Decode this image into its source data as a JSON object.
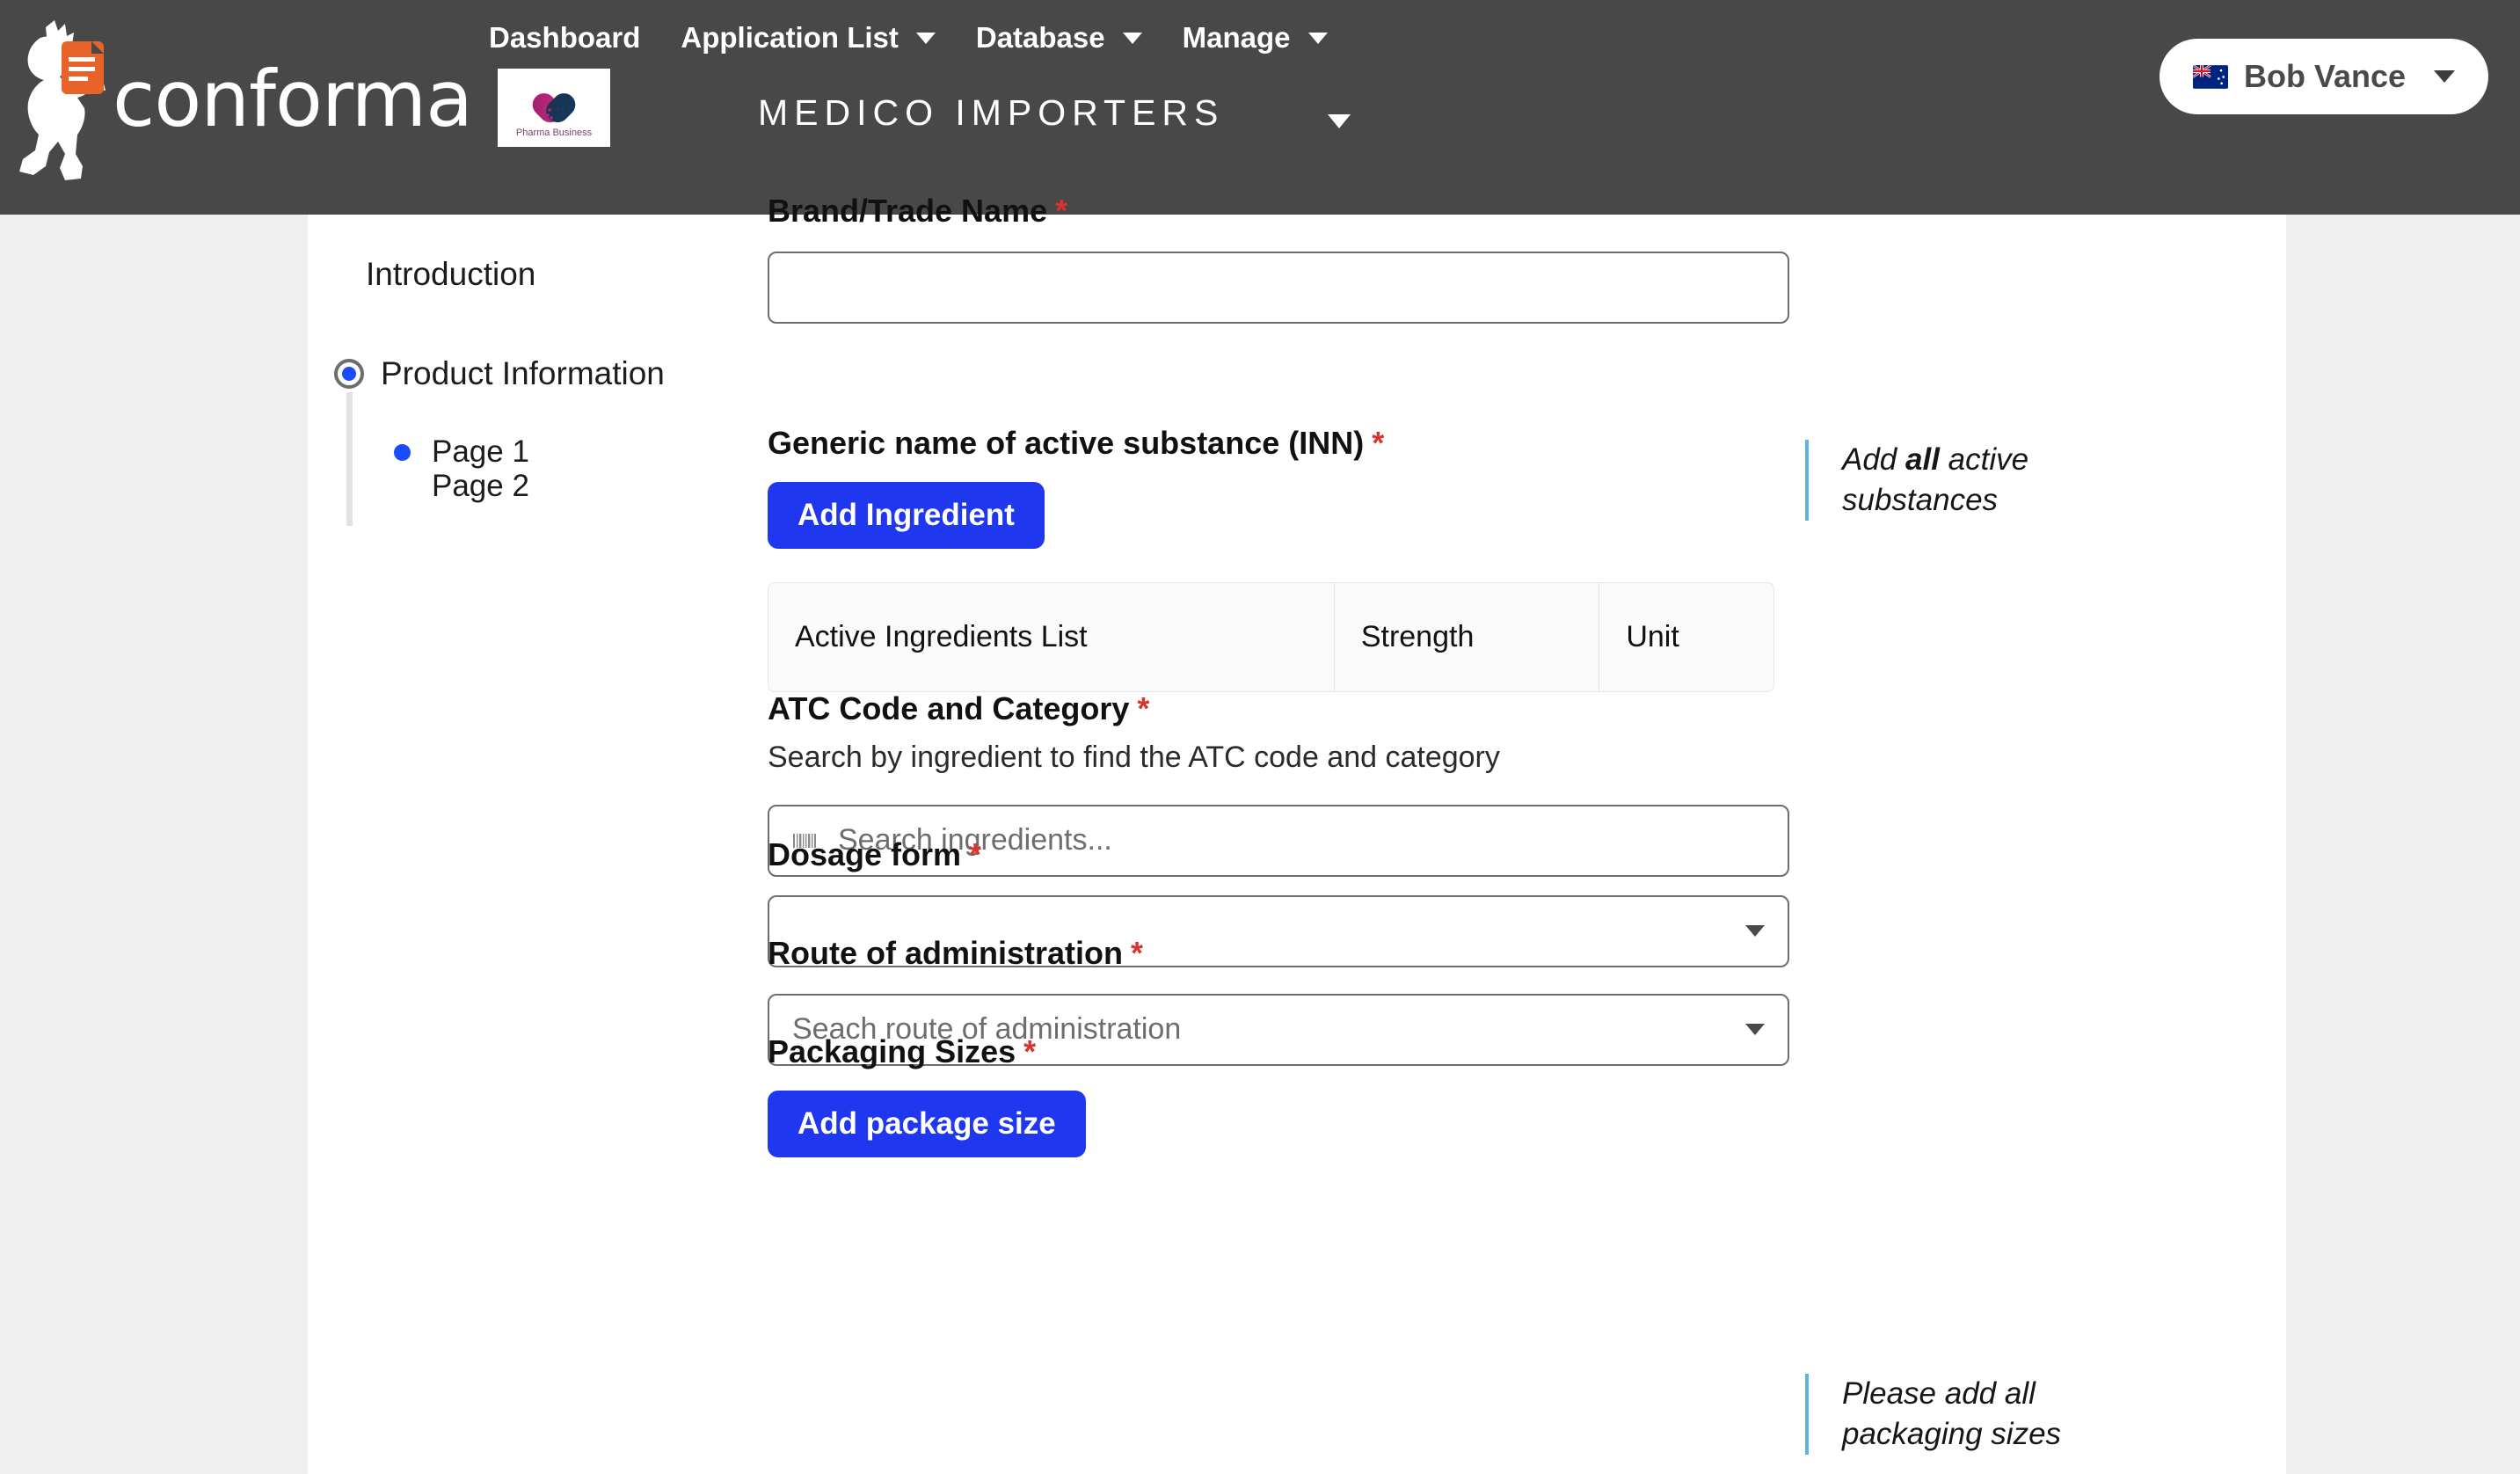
{
  "header": {
    "brand_name": "conforma",
    "brand_icon": "document-icon",
    "mascot_icon": "walking-person-icon",
    "nav": [
      {
        "label": "Dashboard",
        "has_caret": false
      },
      {
        "label": "Application List",
        "has_caret": true
      },
      {
        "label": "Database",
        "has_caret": true
      },
      {
        "label": "Manage",
        "has_caret": true
      }
    ],
    "org_tab": {
      "logo_name": "pharma-business-heart-capsule-logo",
      "logo_caption": "Pharma Business"
    },
    "org_name": "MEDICO IMPORTERS",
    "user": {
      "name": "Bob Vance",
      "flag": "new-zealand-flag-icon"
    },
    "bg_color": "#484848"
  },
  "sidebar": {
    "intro_label": "Introduction",
    "section_label": "Product Information",
    "pages": [
      {
        "label": "Page 1",
        "active": true
      },
      {
        "label": "Page 2",
        "active": false
      }
    ],
    "active_color": "#1b4bff"
  },
  "form": {
    "brand_name": {
      "label": "Brand/Trade Name",
      "required_marker": "*",
      "value": "",
      "placeholder": ""
    },
    "generic_name": {
      "label": "Generic name of active substance (INN)",
      "required_marker": "*",
      "add_button": "Add Ingredient",
      "table_headers": [
        "Active Ingredients List",
        "Strength",
        "Unit"
      ],
      "rows": []
    },
    "atc": {
      "label": "ATC Code and Category",
      "required_marker": "*",
      "help": "Search by ingredient to find the ATC code and category",
      "search_placeholder": "Search ingredients...",
      "search_value": "",
      "search_icon": "barcode-icon"
    },
    "dosage_form": {
      "label": "Dosage form",
      "required_marker": "*",
      "value": "",
      "placeholder": ""
    },
    "route": {
      "label": "Route of administration",
      "required_marker": "*",
      "value": "",
      "placeholder": "Seach route of administration"
    },
    "packaging": {
      "label": "Packaging Sizes",
      "required_marker": "*",
      "add_button": "Add package size"
    },
    "accent_button_color": "#1f37ef",
    "required_color": "#d9342b"
  },
  "hints": {
    "active_substances_prefix": "Add ",
    "active_substances_bold": "all",
    "active_substances_suffix": " active substances",
    "packaging": "Please add all packaging sizes",
    "accent_color": "#5bb3e4"
  }
}
